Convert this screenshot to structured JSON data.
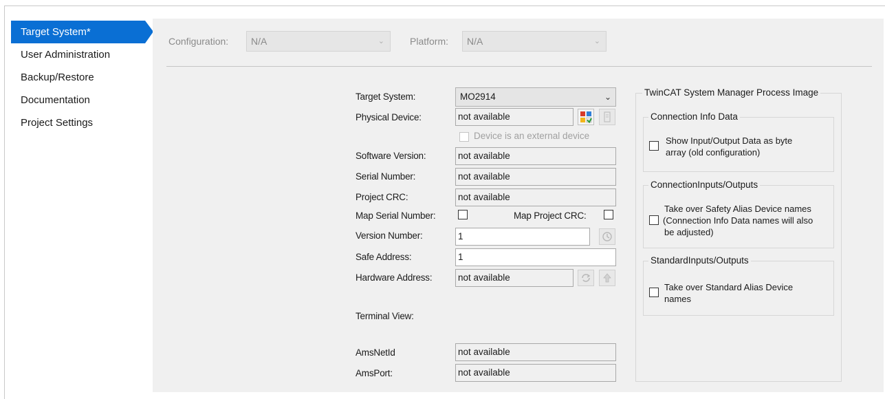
{
  "sidebar": {
    "items": [
      {
        "label": "Target System*"
      },
      {
        "label": "User Administration"
      },
      {
        "label": "Backup/Restore"
      },
      {
        "label": "Documentation"
      },
      {
        "label": "Project Settings"
      }
    ]
  },
  "toolbar": {
    "configuration_label": "Configuration:",
    "configuration_value": "N/A",
    "platform_label": "Platform:",
    "platform_value": "N/A"
  },
  "form": {
    "target_system_label": "Target System:",
    "target_system_value": "MO2914",
    "physical_device_label": "Physical Device:",
    "physical_device_value": "not available",
    "external_device_label": "Device is an external device",
    "software_version_label": "Software Version:",
    "software_version_value": "not available",
    "serial_number_label": "Serial Number:",
    "serial_number_value": "not available",
    "project_crc_label": "Project CRC:",
    "project_crc_value": "not available",
    "map_serial_number_label": "Map Serial Number:",
    "map_project_crc_label": "Map Project CRC:",
    "version_number_label": "Version Number:",
    "version_number_value": "1",
    "safe_address_label": "Safe Address:",
    "safe_address_value": "1",
    "hardware_address_label": "Hardware Address:",
    "hardware_address_value": "not available",
    "terminal_view_label": "Terminal View:",
    "amsnetid_label": "AmsNetId",
    "amsnetid_value": "not available",
    "amsport_label": "AmsPort:",
    "amsport_value": "not available"
  },
  "process_image": {
    "title": "TwinCAT System Manager Process Image",
    "connection_info": {
      "title": "Connection Info Data",
      "checkbox_label_line1": "Show Input/Output Data as byte",
      "checkbox_label_line2": "array (old configuration)"
    },
    "connection_io": {
      "title": "ConnectionInputs/Outputs",
      "checkbox_label_line1": "Take over Safety Alias Device names",
      "checkbox_label_line2": "(Connection Info Data names will also",
      "checkbox_label_line3": "be adjusted)"
    },
    "standard_io": {
      "title": "StandardInputs/Outputs",
      "checkbox_label_line1": "Take over Standard Alias Device",
      "checkbox_label_line2": "names"
    }
  },
  "colors": {
    "accent": "#0a6fd4",
    "panel_bg": "#f0f0f0"
  }
}
